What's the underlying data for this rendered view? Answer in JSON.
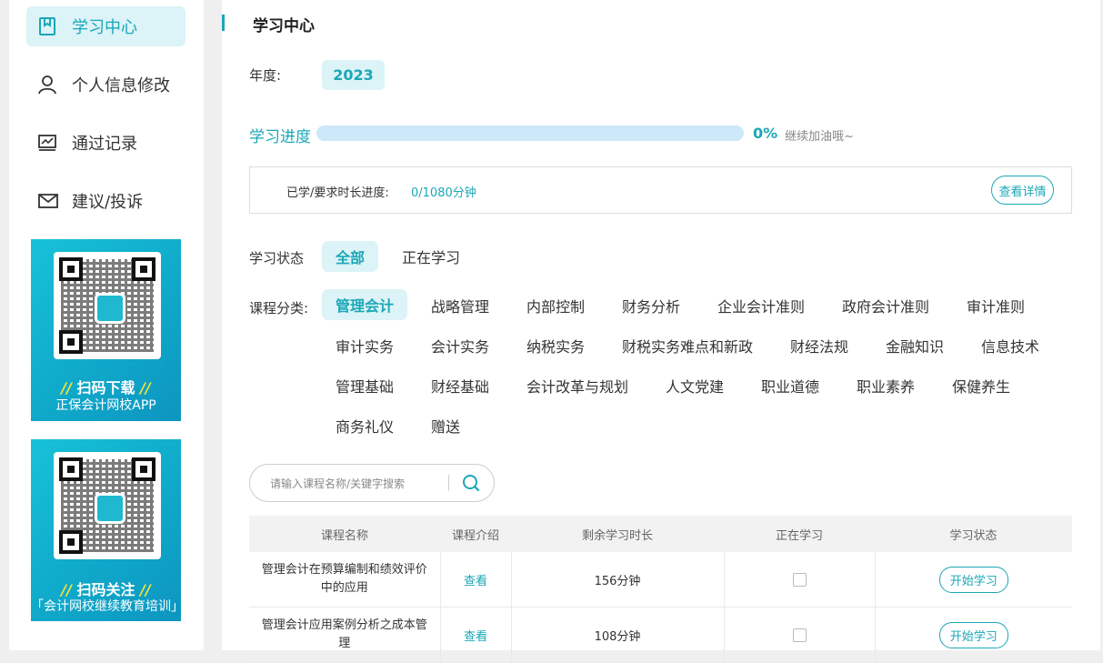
{
  "sidebar": {
    "items": [
      {
        "label": "学习中心",
        "icon": "book-icon"
      },
      {
        "label": "个人信息修改",
        "icon": "user-icon"
      },
      {
        "label": "通过记录",
        "icon": "chart-icon"
      },
      {
        "label": "建议/投诉",
        "icon": "mail-icon"
      }
    ],
    "qr_cards": [
      {
        "title": "扫码下载",
        "subtitle": "正保会计网校APP"
      },
      {
        "title": "扫码关注",
        "subtitle": "「会计网校继续教育培训」"
      }
    ]
  },
  "main": {
    "title": "学习中心",
    "year_label": "年度:",
    "year_value": "2023",
    "progress_label": "学习进度",
    "progress_percent": 0,
    "progress_percent_text": "0%",
    "progress_hint": "继续加油哦~",
    "duration_label": "已学/要求时长进度:",
    "duration_value": "0/1080分钟",
    "detail_button": "查看详情",
    "status_label": "学习状态",
    "status_options": [
      "全部",
      "正在学习"
    ],
    "category_label": "课程分类:",
    "categories": [
      "管理会计",
      "战略管理",
      "内部控制",
      "财务分析",
      "企业会计准则",
      "政府会计准则",
      "审计准则",
      "审计实务",
      "会计实务",
      "纳税实务",
      "财税实务难点和新政",
      "财经法规",
      "金融知识",
      "信息技术",
      "管理基础",
      "财经基础",
      "会计改革与规划",
      "人文党建",
      "职业道德",
      "职业素养",
      "保健养生",
      "商务礼仪",
      "赠送"
    ],
    "search_placeholder": "请输入课程名称/关键字搜索",
    "table": {
      "headers": [
        "课程名称",
        "课程介绍",
        "剩余学习时长",
        "正在学习",
        "学习状态"
      ],
      "rows": [
        {
          "name_line1": "管理会计在预算编制和绩效评价",
          "name_line2": "中的应用",
          "intro": "查看",
          "remaining": "156分钟",
          "action": "开始学习"
        },
        {
          "name_line1": "管理会计应用案例分析之成本管",
          "name_line2": "理",
          "intro": "查看",
          "remaining": "108分钟",
          "action": "开始学习"
        }
      ]
    }
  },
  "colors": {
    "accent": "#1aa7b7",
    "accent_bg": "#dcf3f7",
    "progress_track": "#cde8f8"
  }
}
